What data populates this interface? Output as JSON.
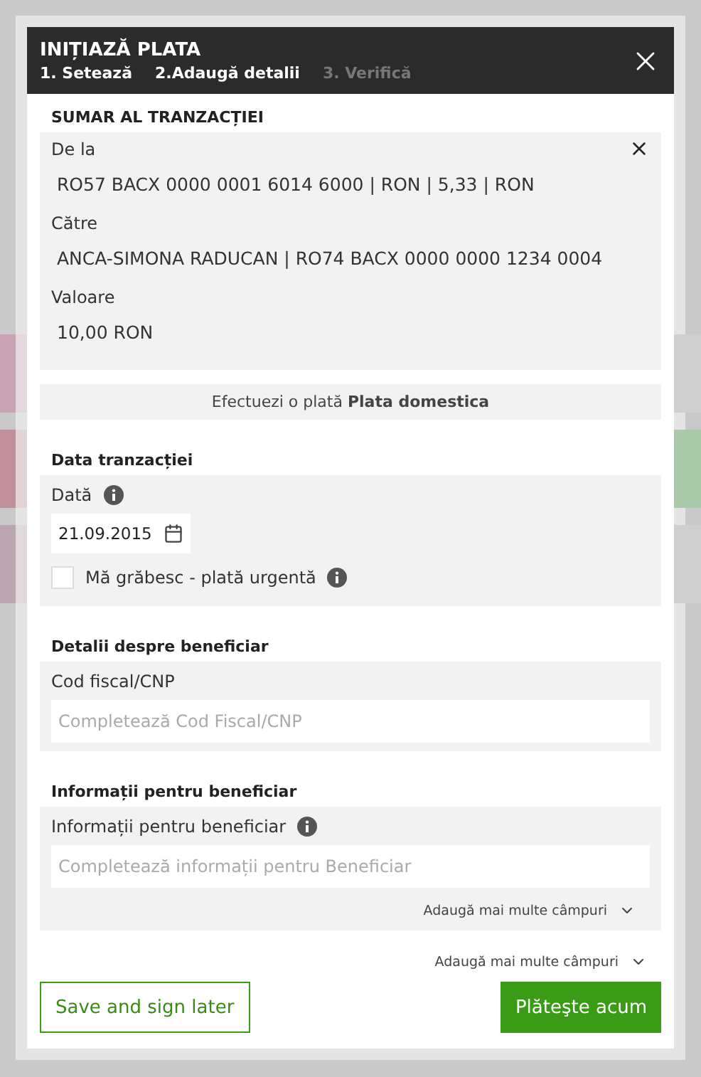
{
  "dialog": {
    "title": "INIȚIAZĂ PLATA",
    "steps": [
      {
        "label": "1. Setează",
        "active": true
      },
      {
        "label": "2.Adaugă detalii",
        "active": true
      },
      {
        "label": "3. Verifică",
        "active": false
      }
    ],
    "summary": {
      "title": "SUMAR AL TRANZACȚIEI",
      "fields": [
        {
          "label": "De la",
          "value": "RO57 BACX 0000 0001 6014 6000 | RON | 5,33 | RON"
        },
        {
          "label": "Către",
          "value": "ANCA-SIMONA RADUCAN | RO74 BACX 0000 0000 1234 0004"
        },
        {
          "label": "Valoare",
          "value": "10,00 RON"
        }
      ]
    },
    "payment_type": {
      "prefix": "Efectuezi o plată",
      "type": "Plata domestica"
    },
    "sections": [
      {
        "kind": "date",
        "title": "Data tranzacției",
        "label": "Dată",
        "info": true,
        "value": "21.09.2015",
        "checkbox": {
          "label": "Mă grăbesc - plată urgentă",
          "checked": false
        }
      },
      {
        "kind": "text",
        "title": "Detalii despre beneficiar",
        "label": "Cod fiscal/CNP",
        "placeholder": "Completează Cod Fiscal/CNP"
      },
      {
        "kind": "text",
        "title": "Informații pentru beneficiar",
        "label": "Informații pentru beneficiar",
        "info": true,
        "placeholder": "Completează informații pentru Beneficiar",
        "more": "Adaugă mai multe câmpuri"
      }
    ],
    "more": "Adaugă mai multe câmpuri",
    "buttons": [
      {
        "label": "Save and sign later",
        "kind": "secondary"
      },
      {
        "label": "Plăteşte acum",
        "kind": "primary"
      }
    ]
  }
}
